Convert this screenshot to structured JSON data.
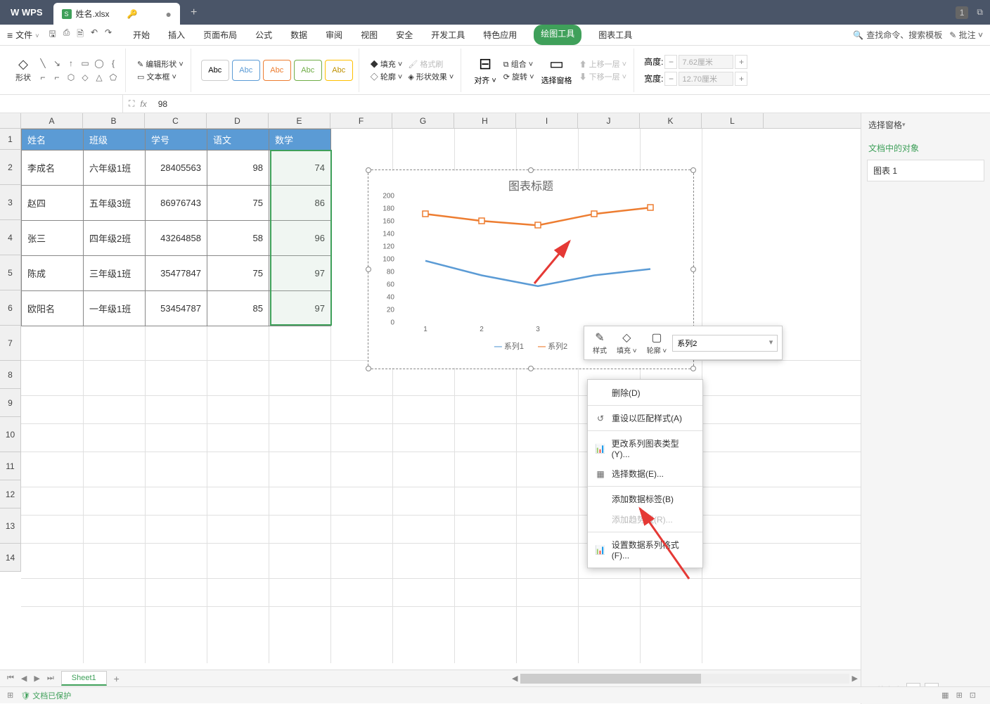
{
  "app": {
    "name": "WPS",
    "filename": "姓名.xlsx",
    "window_badge": "1"
  },
  "maintabs": {
    "file": "文件",
    "items": [
      "开始",
      "插入",
      "页面布局",
      "公式",
      "数据",
      "审阅",
      "视图",
      "安全",
      "开发工具",
      "特色应用",
      "绘图工具",
      "图表工具"
    ],
    "active_index": 10,
    "search_placeholder": "查找命令、搜索模板",
    "comment_btn": "批注"
  },
  "ribbon": {
    "shape_btn": "形状",
    "edit_shape": "编辑形状",
    "textbox": "文本框",
    "abc": "Abc",
    "fill": "填充",
    "outline": "轮廓",
    "format_brush": "格式刷",
    "shape_effects": "形状效果",
    "align": "对齐",
    "group": "组合",
    "rotate": "旋转",
    "selection_pane": "选择窗格",
    "bring_forward": "上移一层",
    "send_backward": "下移一层",
    "height_label": "高度:",
    "width_label": "宽度:",
    "height_val": "7.62厘米",
    "width_val": "12.70厘米"
  },
  "fbar": {
    "namebox": "",
    "fx": "fx",
    "value": "98"
  },
  "columns": [
    "A",
    "B",
    "C",
    "D",
    "E",
    "F",
    "G",
    "H",
    "I",
    "J",
    "K",
    "L"
  ],
  "row_numbers": [
    1,
    2,
    3,
    4,
    5,
    6,
    7,
    8,
    9,
    10,
    11,
    12,
    13,
    14
  ],
  "table": {
    "headers": [
      "姓名",
      "班级",
      "学号",
      "语文",
      "数学"
    ],
    "rows": [
      [
        "李成名",
        "六年级1班",
        "28405563",
        "98",
        "74"
      ],
      [
        "赵四",
        "五年级3班",
        "86976743",
        "75",
        "86"
      ],
      [
        "张三",
        "四年级2班",
        "43264858",
        "58",
        "96"
      ],
      [
        "陈成",
        "三年级1班",
        "35477847",
        "75",
        "97"
      ],
      [
        "欧阳名",
        "一年级1班",
        "53454787",
        "85",
        "97"
      ]
    ]
  },
  "chart_data": {
    "type": "line",
    "title": "图表标题",
    "categories": [
      "1",
      "2",
      "3",
      "4",
      "5"
    ],
    "series": [
      {
        "name": "系列1",
        "values": [
          98,
          75,
          58,
          75,
          85
        ],
        "color": "#5b9bd5"
      },
      {
        "name": "系列2",
        "values": [
          172,
          161,
          154,
          172,
          182
        ],
        "color": "#ed7d31"
      }
    ],
    "ylim": [
      0,
      200
    ],
    "yticks": [
      0,
      20,
      40,
      60,
      80,
      100,
      120,
      140,
      160,
      180,
      200
    ]
  },
  "mini_toolbar": {
    "style": "样式",
    "fill": "填充",
    "outline": "轮廓",
    "selected_series": "系列2"
  },
  "context_menu": {
    "items": [
      {
        "label": "删除(D)",
        "icon": ""
      },
      {
        "label": "重设以匹配样式(A)",
        "icon": "↺"
      },
      {
        "label": "更改系列图表类型(Y)...",
        "icon": "📊"
      },
      {
        "label": "选择数据(E)...",
        "icon": "▦"
      },
      {
        "label": "添加数据标签(B)",
        "icon": ""
      },
      {
        "label": "添加趋势线(R)...",
        "icon": "",
        "disabled": true
      },
      {
        "label": "设置数据系列格式(F)...",
        "icon": "📊"
      }
    ]
  },
  "rightpanel": {
    "title": "选择窗格",
    "section": "文档中的对象",
    "item": "图表 1",
    "order_label": "叠放次序"
  },
  "sheet": {
    "name": "Sheet1"
  },
  "statusbar": {
    "protected": "文档已保护"
  }
}
